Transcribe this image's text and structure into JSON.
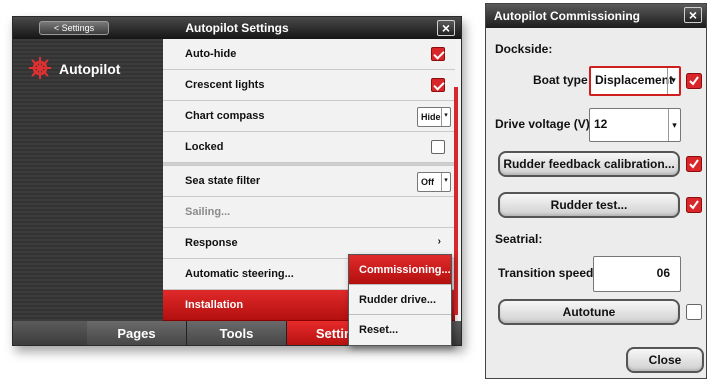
{
  "settings_window": {
    "title": "Autopilot Settings",
    "back_label": "< Settings",
    "close_glyph": "×",
    "sidebar_title": "Autopilot",
    "rows": [
      {
        "label": "Auto-hide"
      },
      {
        "label": "Crescent lights"
      },
      {
        "label": "Chart compass",
        "value": "Hide"
      },
      {
        "label": "Locked"
      },
      {
        "label": "Sea state filter",
        "value": "Off"
      },
      {
        "label": "Sailing..."
      },
      {
        "label": "Response",
        "chevron": "›"
      },
      {
        "label": "Automatic steering..."
      },
      {
        "label": "Installation"
      }
    ],
    "tabs": [
      {
        "label": "Pages"
      },
      {
        "label": "Tools"
      },
      {
        "label": "Settings"
      }
    ],
    "popup": [
      {
        "label": "Commissioning..."
      },
      {
        "label": "Rudder drive..."
      },
      {
        "label": "Reset..."
      }
    ],
    "dropdown_arrow": "▾",
    "colors": {
      "accent": "#d8262a",
      "dark": "#333333"
    }
  },
  "commissioning_window": {
    "title": "Autopilot Commissioning",
    "close_glyph": "×",
    "dockside_label": "Dockside:",
    "boat_type_label": "Boat type",
    "boat_type_value": "Displacement",
    "drive_voltage_label": "Drive voltage (V)",
    "drive_voltage_value": "12",
    "rudder_feedback_label": "Rudder feedback calibration...",
    "rudder_test_label": "Rudder test...",
    "seatrial_label": "Seatrial:",
    "transition_speed_label": "Transition speed",
    "transition_speed_value": "06",
    "autotune_label": "Autotune",
    "close_label": "Close",
    "dropdown_arrow": "▾"
  }
}
